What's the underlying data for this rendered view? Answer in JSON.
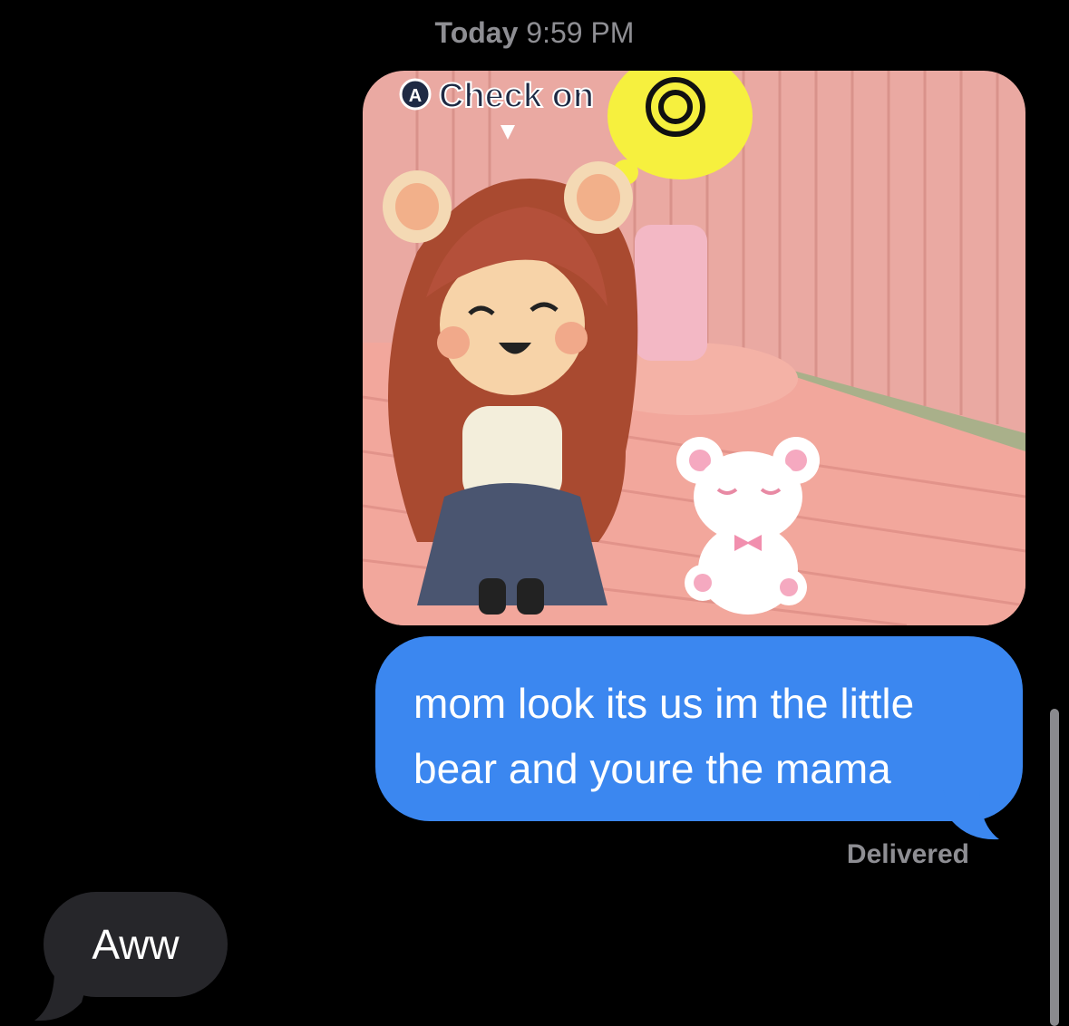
{
  "timestamp": {
    "day": "Today",
    "time": "9:59 PM"
  },
  "messages": {
    "image": {
      "caption_icon_letter": "A",
      "caption_text": "Check on"
    },
    "outgoing_text": "mom look its us im the little bear and youre the mama",
    "delivery_status": "Delivered",
    "incoming_text": "Aww"
  },
  "colors": {
    "outgoing_bubble": "#3b87f0",
    "incoming_bubble": "#26262a",
    "background": "#000000",
    "meta_text": "#8e8e93"
  }
}
